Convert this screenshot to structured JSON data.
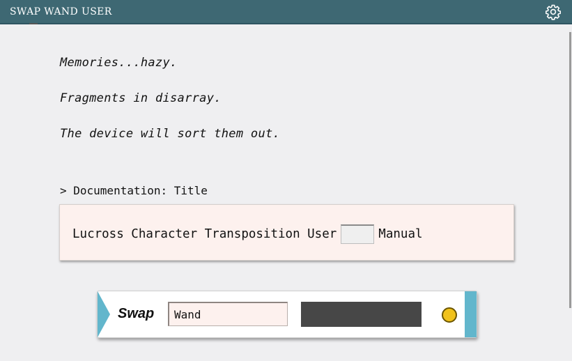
{
  "window": {
    "title": "SWAP WAND USER",
    "settings_icon": "gear-icon"
  },
  "intro": {
    "lines": [
      "Memories...hazy.",
      "Fragments in disarray.",
      "The device will sort them out."
    ]
  },
  "documentation": {
    "label": "> Documentation: Title",
    "title_before": "Lucross Character Transposition User",
    "title_slot_value": "",
    "title_after": "Manual"
  },
  "wand": {
    "label": "Swap",
    "input_value": "Wand",
    "display_text": "",
    "indicator_color": "#f1c21b",
    "accent_color": "#62b6cc"
  },
  "colors": {
    "titlebar": "#3e6873",
    "background": "#efeff1",
    "doc_box": "#fdf1ee"
  }
}
